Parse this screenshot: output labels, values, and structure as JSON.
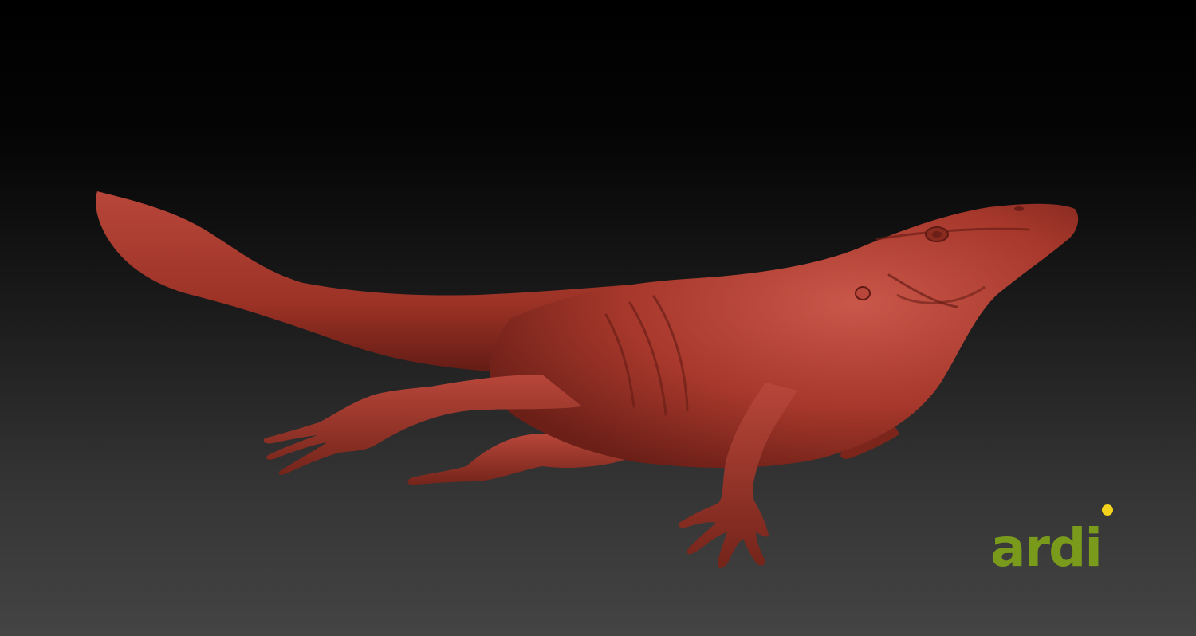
{
  "scene": {
    "subject": "creature-sculpt",
    "background_top_color": "#000000",
    "background_bottom_color": "#444444",
    "clay_color": "#a8382c",
    "clay_shadow_color": "#6b1f17",
    "clay_highlight_color": "#c9574a"
  },
  "logo": {
    "text": "ardi",
    "color": "#7a9a1c",
    "dot_color": "#f2d21b"
  }
}
